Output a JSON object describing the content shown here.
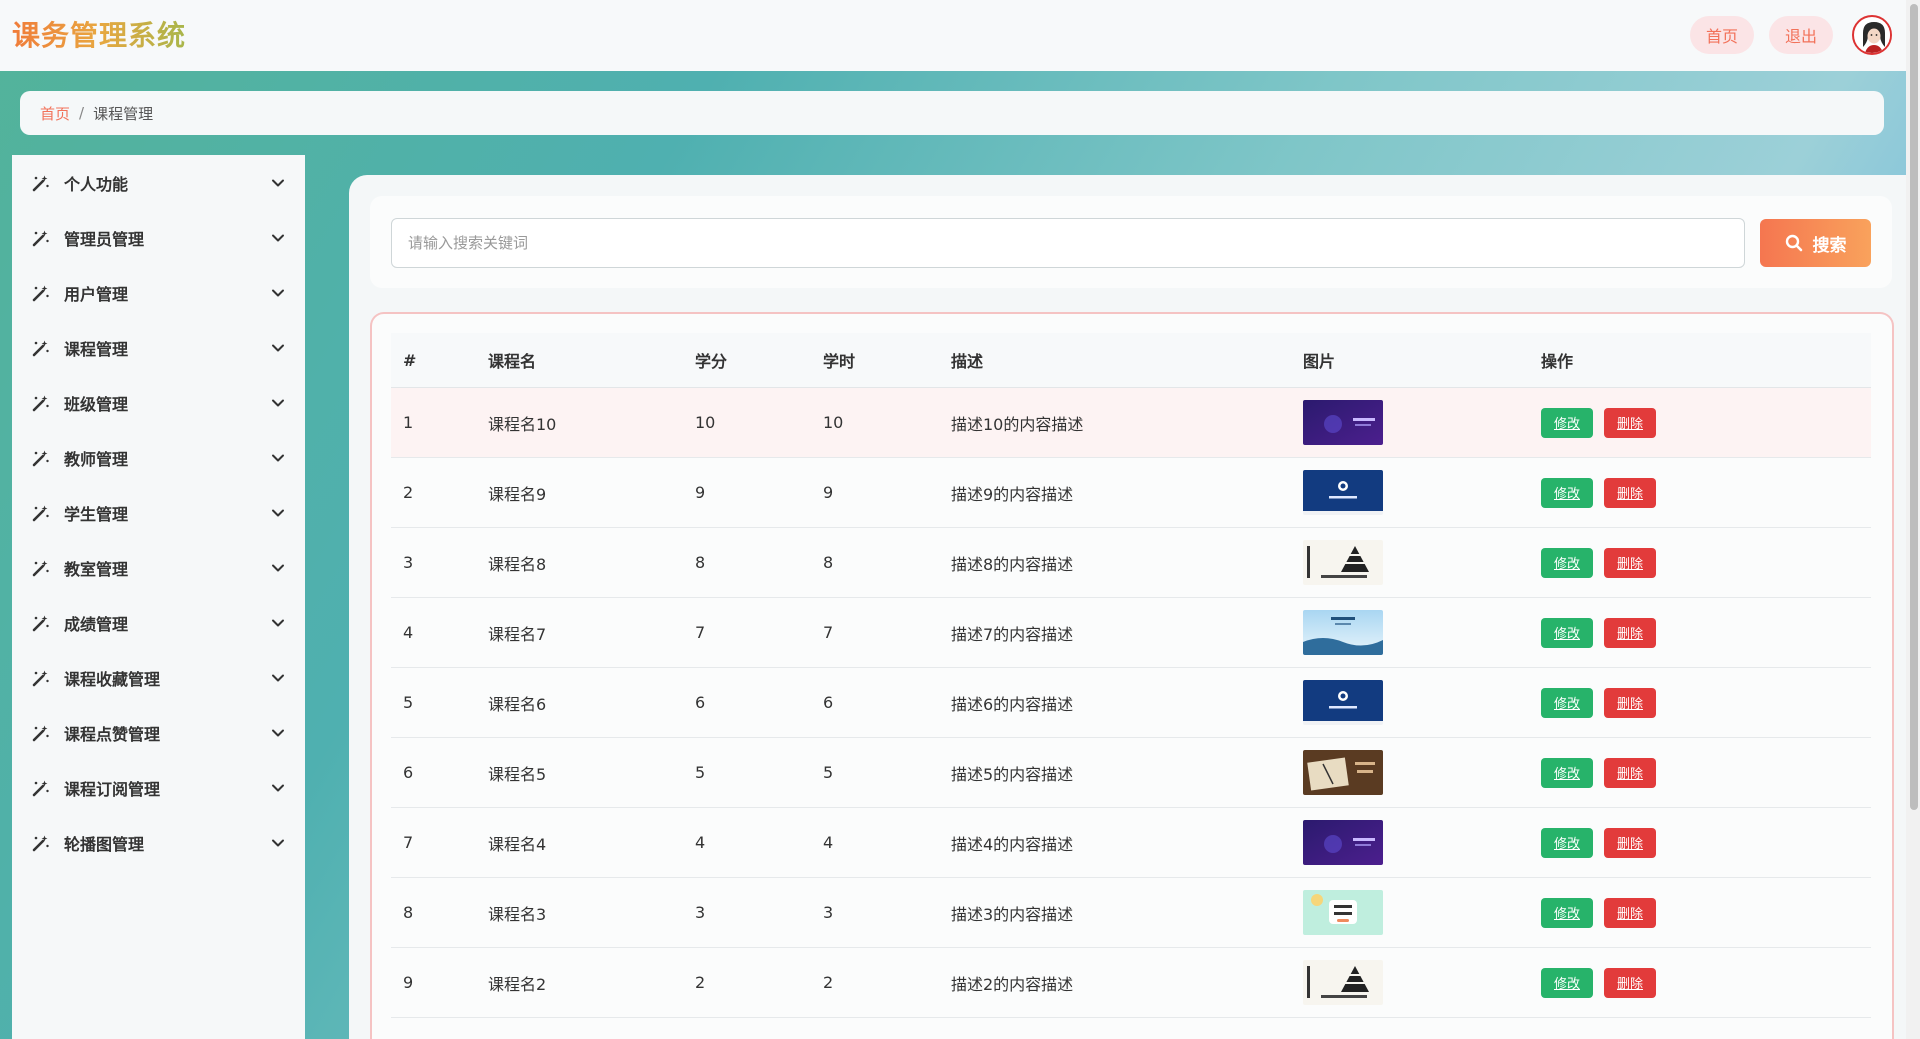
{
  "header": {
    "brand": "课务管理系统",
    "home_label": "首页",
    "logout_label": "退出"
  },
  "breadcrumb": {
    "home": "首页",
    "separator": "/",
    "current": "课程管理"
  },
  "sidebar": {
    "items": [
      {
        "label": "个人功能"
      },
      {
        "label": "管理员管理"
      },
      {
        "label": "用户管理"
      },
      {
        "label": "课程管理"
      },
      {
        "label": "班级管理"
      },
      {
        "label": "教师管理"
      },
      {
        "label": "学生管理"
      },
      {
        "label": "教室管理"
      },
      {
        "label": "成绩管理"
      },
      {
        "label": "课程收藏管理"
      },
      {
        "label": "课程点赞管理"
      },
      {
        "label": "课程订阅管理"
      },
      {
        "label": "轮播图管理"
      }
    ]
  },
  "search": {
    "placeholder": "请输入搜索关键词",
    "button_label": "搜索"
  },
  "table": {
    "columns": [
      "#",
      "课程名",
      "学分",
      "学时",
      "描述",
      "图片",
      "操作"
    ],
    "edit_label": "修改",
    "delete_label": "删除",
    "rows": [
      {
        "index": "1",
        "name": "课程名10",
        "credit": "10",
        "hours": "10",
        "desc": "描述10的内容描述",
        "image": "purple-ai"
      },
      {
        "index": "2",
        "name": "课程名9",
        "credit": "9",
        "hours": "9",
        "desc": "描述9的内容描述",
        "image": "navy-card"
      },
      {
        "index": "3",
        "name": "课程名8",
        "credit": "8",
        "hours": "8",
        "desc": "描述8的内容描述",
        "image": "learning-pyramid"
      },
      {
        "index": "4",
        "name": "课程名7",
        "credit": "7",
        "hours": "7",
        "desc": "描述7的内容描述",
        "image": "light-blue-landscape"
      },
      {
        "index": "5",
        "name": "课程名6",
        "credit": "6",
        "hours": "6",
        "desc": "描述6的内容描述",
        "image": "navy-card"
      },
      {
        "index": "6",
        "name": "课程名5",
        "credit": "5",
        "hours": "5",
        "desc": "描述5的内容描述",
        "image": "book-desk"
      },
      {
        "index": "7",
        "name": "课程名4",
        "credit": "4",
        "hours": "4",
        "desc": "描述4的内容描述",
        "image": "purple-ai"
      },
      {
        "index": "8",
        "name": "课程名3",
        "credit": "3",
        "hours": "3",
        "desc": "描述3的内容描述",
        "image": "mint-study"
      },
      {
        "index": "9",
        "name": "课程名2",
        "credit": "2",
        "hours": "2",
        "desc": "描述2的内容描述",
        "image": "learning-pyramid"
      }
    ]
  }
}
